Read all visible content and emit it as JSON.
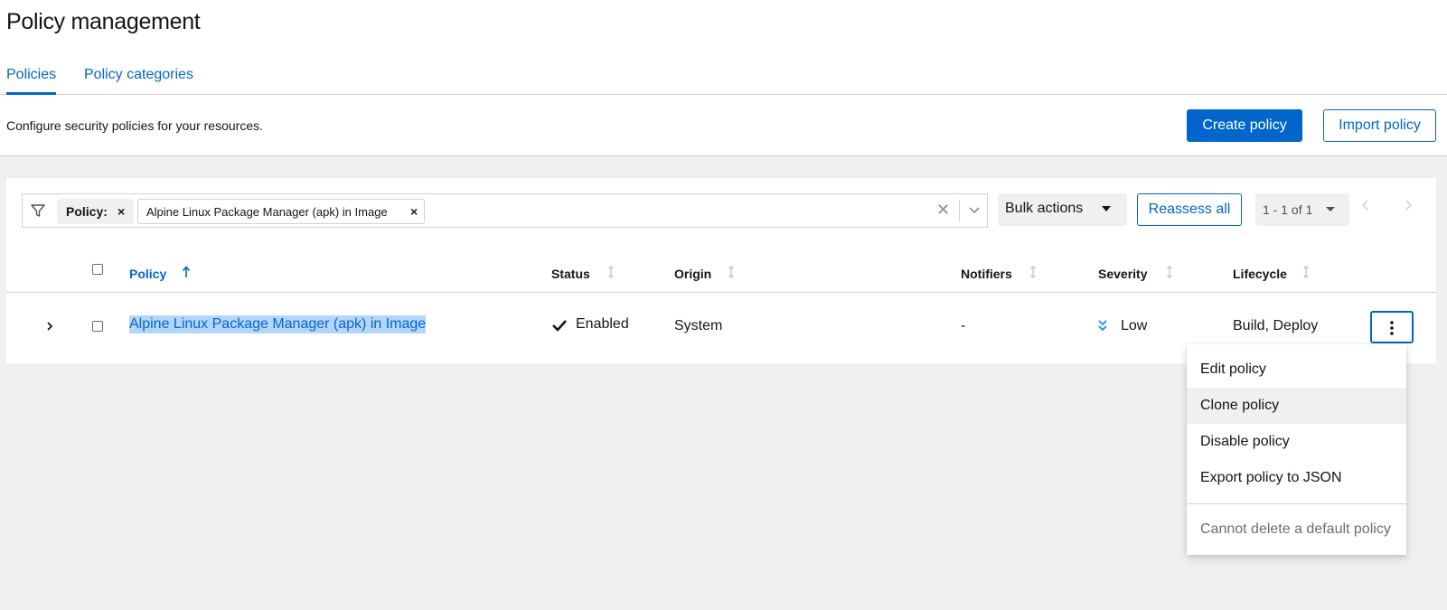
{
  "page": {
    "title": "Policy management",
    "tabs": [
      {
        "label": "Policies",
        "active": true
      },
      {
        "label": "Policy categories",
        "active": false
      }
    ],
    "description": "Configure security policies for your resources.",
    "create_label": "Create policy",
    "import_label": "Import policy"
  },
  "toolbar": {
    "filter_category": "Policy:",
    "filter_chip": "Alpine Linux Package Manager (apk) in Image",
    "chip_close": "×",
    "clear_glyph": "✕",
    "bulk_label": "Bulk actions",
    "reassess_label": "Reassess all",
    "pagination_text": "1 - 1 of 1"
  },
  "table": {
    "columns": [
      "Policy",
      "Status",
      "Origin",
      "Notifiers",
      "Severity",
      "Lifecycle"
    ],
    "sorted_column": "Policy",
    "rows": [
      {
        "policy": "Alpine Linux Package Manager (apk) in Image",
        "status": "Enabled",
        "origin": "System",
        "notifiers": "-",
        "severity": "Low",
        "lifecycle": "Build, Deploy"
      }
    ]
  },
  "row_menu": {
    "items": [
      "Edit policy",
      "Clone policy",
      "Disable policy",
      "Export policy to JSON"
    ],
    "disabled_item": "Cannot delete a default policy",
    "hovered_item": "Clone policy"
  },
  "icons": {
    "filter": "filter-icon",
    "sort": "sort-icon",
    "expand": "chevron-right-icon",
    "status": "check-icon",
    "severity": "double-chevron-down-icon",
    "kebab": "kebab-icon"
  },
  "colors": {
    "accent": "#0066cc",
    "selection": "#b4d5fe",
    "severity_low": "#2b9af3",
    "page_bg": "#f0f0f0"
  }
}
